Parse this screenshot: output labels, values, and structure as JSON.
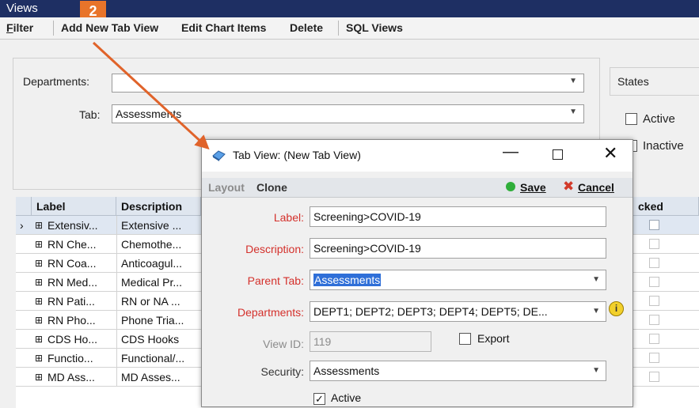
{
  "window": {
    "title": "Views",
    "badge": "2"
  },
  "menu": {
    "filter": "Filter",
    "add_new_tab_view": "Add New Tab View",
    "edit_chart_items": "Edit Chart Items",
    "delete": "Delete",
    "sql_views": "SQL Views"
  },
  "filters": {
    "departments_label": "Departments:",
    "departments_value": "",
    "tab_label": "Tab:",
    "tab_value": "Assessments"
  },
  "states": {
    "title": "States",
    "active_label": "Active",
    "active_checked": false,
    "inactive_label": "Inactive",
    "inactive_checked": false
  },
  "grid": {
    "columns": {
      "label": "Label",
      "description": "Description",
      "locked": "cked"
    },
    "rows": [
      {
        "label": "Extensiv...",
        "description": "Extensive ..."
      },
      {
        "label": "RN Che...",
        "description": "Chemothe..."
      },
      {
        "label": "RN Coa...",
        "description": "Anticoagul..."
      },
      {
        "label": "RN Med...",
        "description": "Medical Pr..."
      },
      {
        "label": "RN Pati...",
        "description": "RN or NA ..."
      },
      {
        "label": "RN Pho...",
        "description": "Phone Tria..."
      },
      {
        "label": "CDS Ho...",
        "description": "CDS Hooks"
      },
      {
        "label": "Functio...",
        "description": "Functional/..."
      },
      {
        "label": "MD Ass...",
        "description": "MD Asses..."
      }
    ]
  },
  "dialog": {
    "title": "Tab View: (New Tab View)",
    "toolbar": {
      "layout": "Layout",
      "clone": "Clone",
      "save": "Save",
      "cancel": "Cancel"
    },
    "fields": {
      "label_label": "Label:",
      "label_value": "Screening>COVID-19",
      "description_label": "Description:",
      "description_value": "Screening>COVID-19",
      "parent_tab_label": "Parent Tab:",
      "parent_tab_value": "Assessments",
      "departments_label": "Departments:",
      "departments_value": "DEPT1; DEPT2; DEPT3; DEPT4; DEPT5; DE...",
      "view_id_label": "View ID:",
      "view_id_value": "119",
      "export_label": "Export",
      "export_checked": false,
      "security_label": "Security:",
      "security_value": "Assessments",
      "active_label": "Active",
      "active_checked": true
    }
  },
  "colors": {
    "titlebar": "#1e2f63",
    "badge": "#e8742a",
    "arrow": "#e0632a",
    "required_label": "#d4302b",
    "save_green": "#2fae3a",
    "cancel_red": "#d23a2a",
    "selection": "#2f6fd8"
  }
}
